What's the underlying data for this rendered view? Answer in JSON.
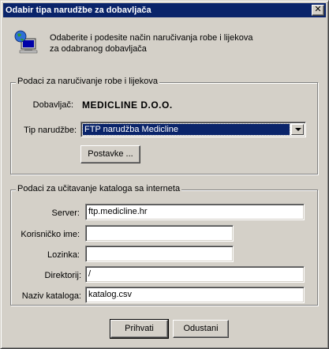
{
  "window": {
    "title": "Odabir tipa narudžbe za dobavljača"
  },
  "intro": {
    "line1": "Odaberite i podesite način naručivanja robe i lijekova",
    "line2": "za odabranog dobavljača"
  },
  "order_group": {
    "title": "Podaci za naručivanje robe i lijekova",
    "supplier_label": "Dobavljač:",
    "supplier_value": "MEDICLINE D.O.O.",
    "order_type_label": "Tip narudžbe:",
    "order_type_value": "FTP narudžba Medicline",
    "settings_button": "Postavke ..."
  },
  "catalog_group": {
    "title": "Podaci za učitavanje kataloga sa interneta",
    "server_label": "Server:",
    "server_value": "ftp.medicline.hr",
    "username_label": "Korisničko ime:",
    "username_value": "",
    "password_label": "Lozinka:",
    "password_value": "",
    "directory_label": "Direktorij:",
    "directory_value": "/",
    "catalog_name_label": "Naziv kataloga:",
    "catalog_name_value": "katalog.csv"
  },
  "buttons": {
    "accept": "Prihvati",
    "cancel": "Odustani"
  },
  "icons": {
    "close": "close-icon",
    "intro": "computer-globe-icon"
  },
  "colors": {
    "titlebar": "#0a246a",
    "face": "#d4d0c8",
    "highlight": "#0a246a"
  }
}
